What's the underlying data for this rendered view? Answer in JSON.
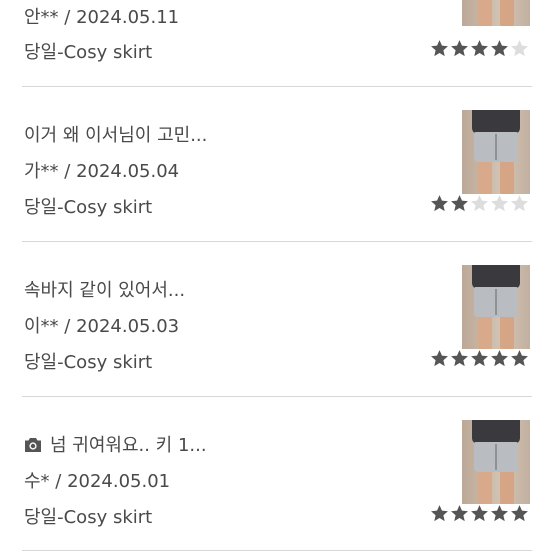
{
  "reviews": [
    {
      "title": "",
      "meta": "안** / 2024.05.11",
      "product": "당일-Cosy skirt",
      "rating": 4,
      "has_photo_icon": false
    },
    {
      "title": "이거 왜 이서님이 고민...",
      "meta": "가** / 2024.05.04",
      "product": "당일-Cosy skirt",
      "rating": 2,
      "has_photo_icon": false
    },
    {
      "title": "속바지 같이 있어서...",
      "meta": "이** / 2024.05.03",
      "product": "당일-Cosy skirt",
      "rating": 5,
      "has_photo_icon": false
    },
    {
      "title": "넘 귀여워요.. 키 1...",
      "meta": "수* / 2024.05.01",
      "product": "당일-Cosy skirt",
      "rating": 5,
      "has_photo_icon": true
    }
  ],
  "colors": {
    "star_filled": "#555555",
    "star_empty": "#dddddd",
    "divider": "#d8d8d8",
    "text": "#4a4a4a"
  },
  "icons": {
    "photo": "camera-icon",
    "star": "star-icon"
  }
}
